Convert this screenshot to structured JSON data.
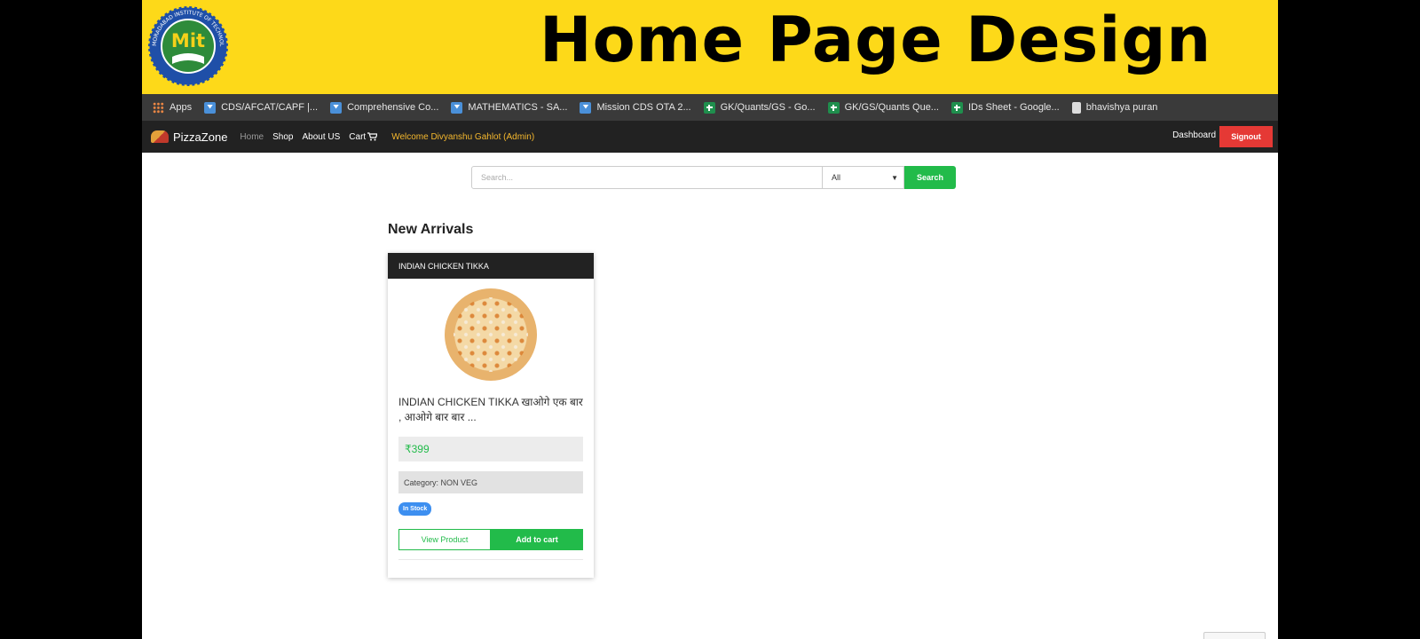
{
  "banner": {
    "title": "Home Page Design",
    "logo_text": "Mit",
    "logo_ring_text": "MORADABAD INSTITUTE OF TECHNOLOGY",
    "logo_colors": {
      "ring": "#1f4fa8",
      "center": "#2e8b3a",
      "letters": "#f5d11a"
    }
  },
  "bookmarks": {
    "items": [
      {
        "label": "Apps",
        "icon": "apps-grid-icon"
      },
      {
        "label": "CDS/AFCAT/CAPF |...",
        "icon": "forms-icon"
      },
      {
        "label": "Comprehensive Co...",
        "icon": "forms-icon"
      },
      {
        "label": "MATHEMATICS - SA...",
        "icon": "forms-icon"
      },
      {
        "label": "Mission CDS OTA 2...",
        "icon": "forms-icon"
      },
      {
        "label": "GK/Quants/GS - Go...",
        "icon": "sheets-icon"
      },
      {
        "label": "GK/GS/Quants Que...",
        "icon": "sheets-icon"
      },
      {
        "label": "IDs Sheet - Google...",
        "icon": "sheets-icon"
      },
      {
        "label": "bhavishya puran",
        "icon": "document-icon"
      }
    ]
  },
  "navbar": {
    "brand": "PizzaZone",
    "links": {
      "home": "Home",
      "shop": "Shop",
      "about": "About US",
      "cart": "Cart"
    },
    "welcome": "Welcome Divyanshu Gahlot (Admin)",
    "dashboard": "Dashboard",
    "signout": "Signout"
  },
  "search": {
    "placeholder": "Search...",
    "category_selected": "All",
    "button": "Search"
  },
  "main": {
    "section_title": "New Arrivals",
    "product": {
      "name": "INDIAN CHICKEN TIKKA",
      "description": "INDIAN CHICKEN TIKKA खाओगे एक बार , आओगे बार बार ...",
      "price": "₹399",
      "category": "Category: NON VEG",
      "stock": "In Stock",
      "view_button": "View Product",
      "cart_button": "Add to cart"
    }
  },
  "colors": {
    "banner_bg": "#fdd919",
    "navbar_bg": "#222222",
    "accent_green": "#22bb4a",
    "signout_red": "#e53935",
    "stock_blue": "#3d8ff0",
    "welcome_orange": "#f5b82e"
  }
}
